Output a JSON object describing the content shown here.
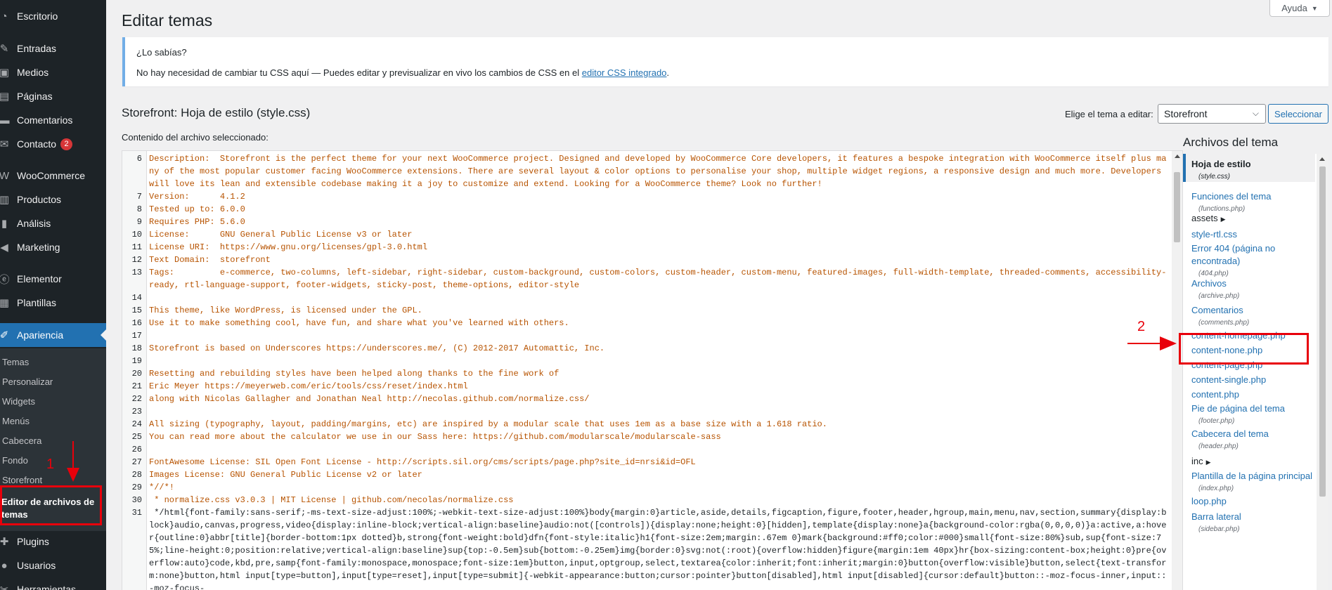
{
  "sidebar": {
    "menu": [
      {
        "label": "Escritorio",
        "icon": "dashboard-icon",
        "glyph": "◔"
      },
      {
        "label": "Entradas",
        "icon": "pin-icon",
        "glyph": "✎"
      },
      {
        "label": "Medios",
        "icon": "media-icon",
        "glyph": "▣"
      },
      {
        "label": "Páginas",
        "icon": "pages-icon",
        "glyph": "▤"
      },
      {
        "label": "Comentarios",
        "icon": "comments-icon",
        "glyph": "▬"
      },
      {
        "label": "Contacto",
        "icon": "mail-icon",
        "glyph": "✉",
        "badge": "2"
      },
      {
        "label": "WooCommerce",
        "icon": "woocommerce-icon",
        "glyph": "W"
      },
      {
        "label": "Productos",
        "icon": "products-icon",
        "glyph": "▥"
      },
      {
        "label": "Análisis",
        "icon": "analytics-icon",
        "glyph": "▮"
      },
      {
        "label": "Marketing",
        "icon": "megaphone-icon",
        "glyph": "◀"
      },
      {
        "label": "Elementor",
        "icon": "elementor-icon",
        "glyph": "ⓔ"
      },
      {
        "label": "Plantillas",
        "icon": "templates-icon",
        "glyph": "▦"
      },
      {
        "label": "Apariencia",
        "icon": "brush-icon",
        "glyph": "✐"
      },
      {
        "label": "Plugins",
        "icon": "plugin-icon",
        "glyph": "✚"
      },
      {
        "label": "Usuarios",
        "icon": "user-icon",
        "glyph": "●"
      },
      {
        "label": "Herramientas",
        "icon": "tools-icon",
        "glyph": "✂"
      }
    ],
    "submenu": [
      "Temas",
      "Personalizar",
      "Widgets",
      "Menús",
      "Cabecera",
      "Fondo",
      "Storefront",
      "Editor de archivos de temas"
    ]
  },
  "help_label": "Ayuda",
  "page_title": "Editar temas",
  "notice": {
    "title": "¿Lo sabías?",
    "text": "No hay necesidad de cambiar tu CSS aquí — Puedes editar y previsualizar en vivo los cambios de CSS en el",
    "link": "editor CSS integrado",
    "suffix": "."
  },
  "file_title": "Storefront: Hoja de estilo (style.css)",
  "theme_label": "Elige el tema a editar:",
  "theme_selected": "Storefront",
  "select_button": "Seleccionar",
  "content_label": "Contenido del archivo seleccionado:",
  "code": [
    {
      "n": "6",
      "text": "Description:  Storefront is the perfect theme for your next WooCommerce project. Designed and developed by WooCommerce Core developers, it features a bespoke integration with WooCommerce itself plus many of the most popular customer facing WooCommerce extensions. There are several layout & color options to personalise your shop, multiple widget regions, a responsive design and much more. Developers will love its lean and extensible codebase making it a joy to customize and extend. Looking for a WooCommerce theme? Look no further!"
    },
    {
      "n": "7",
      "text": "Version:      4.1.2"
    },
    {
      "n": "8",
      "text": "Tested up to: 6.0.0"
    },
    {
      "n": "9",
      "text": "Requires PHP: 5.6.0"
    },
    {
      "n": "10",
      "text": "License:      GNU General Public License v3 or later"
    },
    {
      "n": "11",
      "text": "License URI:  https://www.gnu.org/licenses/gpl-3.0.html"
    },
    {
      "n": "12",
      "text": "Text Domain:  storefront"
    },
    {
      "n": "13",
      "text": "Tags:         e-commerce, two-columns, left-sidebar, right-sidebar, custom-background, custom-colors, custom-header, custom-menu, featured-images, full-width-template, threaded-comments, accessibility-ready, rtl-language-support, footer-widgets, sticky-post, theme-options, editor-style"
    },
    {
      "n": "14",
      "text": ""
    },
    {
      "n": "15",
      "text": "This theme, like WordPress, is licensed under the GPL."
    },
    {
      "n": "16",
      "text": "Use it to make something cool, have fun, and share what you've learned with others."
    },
    {
      "n": "17",
      "text": ""
    },
    {
      "n": "18",
      "text": "Storefront is based on Underscores https://underscores.me/, (C) 2012-2017 Automattic, Inc."
    },
    {
      "n": "19",
      "text": ""
    },
    {
      "n": "20",
      "text": "Resetting and rebuilding styles have been helped along thanks to the fine work of"
    },
    {
      "n": "21",
      "text": "Eric Meyer https://meyerweb.com/eric/tools/css/reset/index.html"
    },
    {
      "n": "22",
      "text": "along with Nicolas Gallagher and Jonathan Neal http://necolas.github.com/normalize.css/"
    },
    {
      "n": "23",
      "text": ""
    },
    {
      "n": "24",
      "text": "All sizing (typography, layout, padding/margins, etc) are inspired by a modular scale that uses 1em as a base size with a 1.618 ratio."
    },
    {
      "n": "25",
      "text": "You can read more about the calculator we use in our Sass here: https://github.com/modularscale/modularscale-sass"
    },
    {
      "n": "26",
      "text": ""
    },
    {
      "n": "27",
      "text": "FontAwesome License: SIL Open Font License - http://scripts.sil.org/cms/scripts/page.php?site_id=nrsi&id=OFL"
    },
    {
      "n": "28",
      "text": "Images License: GNU General Public License v2 or later"
    },
    {
      "n": "29",
      "text": "*//*!"
    },
    {
      "n": "30",
      "text": " * normalize.css v3.0.3 | MIT License | github.com/necolas/normalize.css"
    },
    {
      "n": "31",
      "text": " */html{font-family:sans-serif;-ms-text-size-adjust:100%;-webkit-text-size-adjust:100%}body{margin:0}article,aside,details,figcaption,figure,footer,header,hgroup,main,menu,nav,section,summary{display:block}audio,canvas,progress,video{display:inline-block;vertical-align:baseline}audio:not([controls]){display:none;height:0}[hidden],template{display:none}a{background-color:rgba(0,0,0,0)}a:active,a:hover{outline:0}abbr[title]{border-bottom:1px dotted}b,strong{font-weight:bold}dfn{font-style:italic}h1{font-size:2em;margin:.67em 0}mark{background:#ff0;color:#000}small{font-size:80%}sub,sup{font-size:75%;line-height:0;position:relative;vertical-align:baseline}sup{top:-0.5em}sub{bottom:-0.25em}img{border:0}svg:not(:root){overflow:hidden}figure{margin:1em 40px}hr{box-sizing:content-box;height:0}pre{overflow:auto}code,kbd,pre,samp{font-family:monospace,monospace;font-size:1em}button,input,optgroup,select,textarea{color:inherit;font:inherit;margin:0}button{overflow:visible}button,select{text-transform:none}button,html input[type=button],input[type=reset],input[type=submit]{-webkit-appearance:button;cursor:pointer}button[disabled],html input[disabled]{cursor:default}button::-moz-focus-inner,input::-moz-focus-"
    }
  ],
  "files_title": "Archivos del tema",
  "files": [
    {
      "kind": "file",
      "name": "Hoja de estilo",
      "sub": "(style.css)",
      "active": true
    },
    {
      "kind": "file",
      "name": "Funciones del tema",
      "sub": "(functions.php)"
    },
    {
      "kind": "folder",
      "name": "assets"
    },
    {
      "kind": "file",
      "name": "style-rtl.css"
    },
    {
      "kind": "file",
      "name": "Error 404 (página no encontrada)",
      "sub": "(404.php)"
    },
    {
      "kind": "file",
      "name": "Archivos",
      "sub": "(archive.php)"
    },
    {
      "kind": "file",
      "name": "Comentarios",
      "sub": "(comments.php)"
    },
    {
      "kind": "file",
      "name": "content-homepage.php"
    },
    {
      "kind": "file",
      "name": "content-none.php"
    },
    {
      "kind": "file",
      "name": "content-page.php"
    },
    {
      "kind": "file",
      "name": "content-single.php"
    },
    {
      "kind": "file",
      "name": "content.php"
    },
    {
      "kind": "file",
      "name": "Pie de página del tema",
      "sub": "(footer.php)"
    },
    {
      "kind": "file",
      "name": "Cabecera del tema",
      "sub": "(header.php)"
    },
    {
      "kind": "folder",
      "name": "inc"
    },
    {
      "kind": "file",
      "name": "Plantilla de la página principal",
      "sub": "(index.php)"
    },
    {
      "kind": "file",
      "name": "loop.php"
    },
    {
      "kind": "file",
      "name": "Barra lateral",
      "sub": "(sidebar.php)"
    }
  ],
  "annotations": {
    "one": "1",
    "two": "2",
    "color": "#e8000b"
  },
  "colors": {
    "sidebar": "#1d2327",
    "accent": "#2271b1",
    "badge": "#d63638",
    "code_text": "#b75300"
  }
}
